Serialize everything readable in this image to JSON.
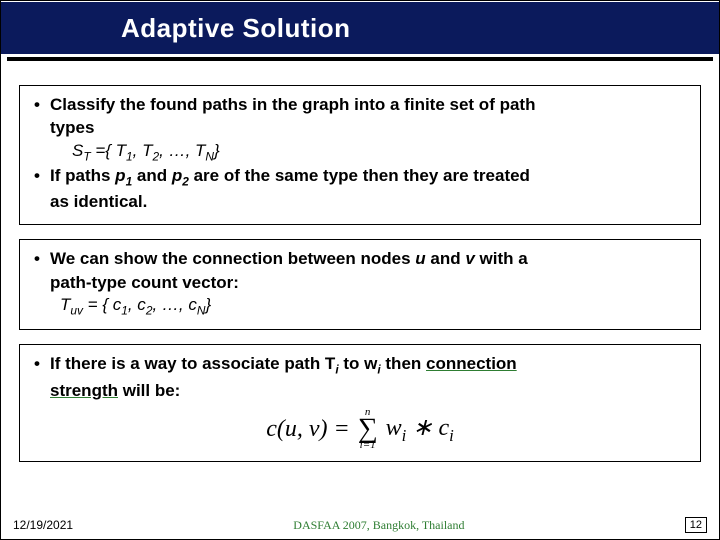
{
  "title": "Adaptive Solution",
  "box1": {
    "bullet1_a": "Classify the found paths in the graph  into a finite set of path",
    "bullet1_b": "types",
    "formula_S": "S",
    "formula_Tsub": "T",
    "formula_eq": " ={ T",
    "formula_1": "1",
    "formula_c1": ", T",
    "formula_2": "2",
    "formula_c2": ", …, T",
    "formula_N": "N",
    "formula_end": "}",
    "bullet2_a": "If paths ",
    "bullet2_p1": "p",
    "bullet2_p1s": "1",
    "bullet2_b": " and ",
    "bullet2_p2": "p",
    "bullet2_p2s": "2",
    "bullet2_c": " are of the same type then they are treated",
    "bullet2_d": "as identical."
  },
  "box2": {
    "bullet_a": "We can show the connection between nodes ",
    "u": "u",
    "bullet_b": " and ",
    "v": "v",
    "bullet_c": " with a",
    "bullet_d": "path-type count vector:",
    "formula_T": "T",
    "formula_uv": "uv",
    "formula_eq": " = { c",
    "formula_1": "1",
    "formula_c1": ", c",
    "formula_2": "2",
    "formula_c2": ", …, c",
    "formula_N": "N",
    "formula_end": "}"
  },
  "box3": {
    "bullet_a": "If there is a way to associate path T",
    "bullet_i": "i",
    "bullet_b": " to w",
    "bullet_i2": "i",
    "bullet_c": " then ",
    "conn": "connection",
    "strength": "strength",
    "bullet_d": " will be:",
    "eq_lhs1": "c(u, v) =",
    "eq_sum_top": "n",
    "eq_sum_sym": "∑",
    "eq_sum_bot": "i=1",
    "eq_w": "w",
    "eq_wi": "i",
    "eq_star": " ∗ ",
    "eq_c": "c",
    "eq_ci": "i"
  },
  "footer": {
    "date": "12/19/2021",
    "venue": "DASFAA 2007, Bangkok, Thailand",
    "page": "12"
  }
}
